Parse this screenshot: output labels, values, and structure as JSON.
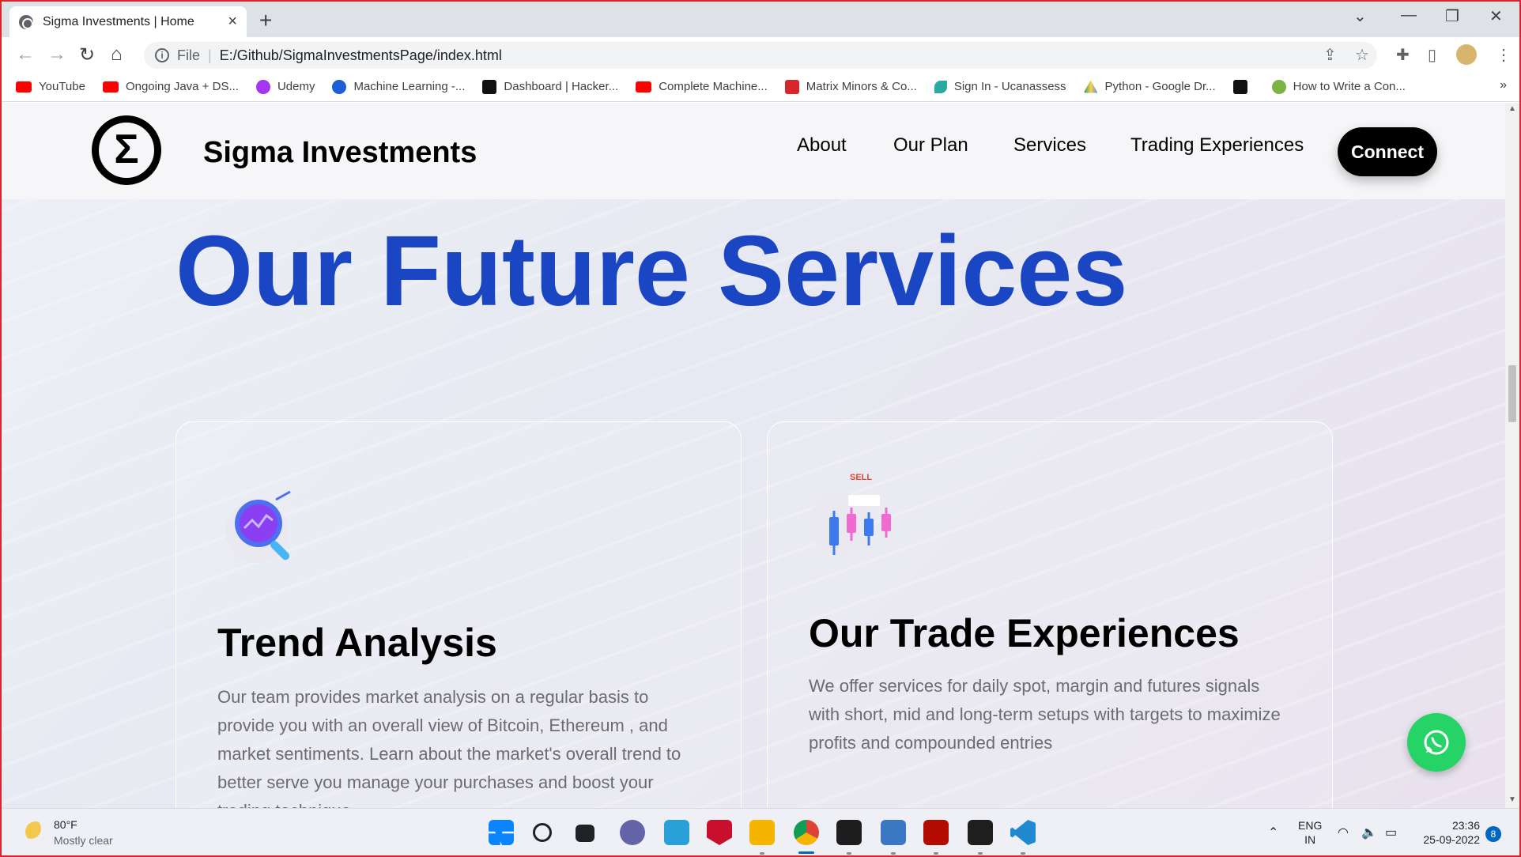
{
  "browser": {
    "tab_title": "Sigma Investments | Home",
    "address_scheme": "File",
    "address_url": "E:/Github/SigmaInvestmentsPage/index.html",
    "bookmarks": [
      {
        "label": "YouTube",
        "color": "#ff0000"
      },
      {
        "label": "Ongoing Java + DS...",
        "color": "#ff0000"
      },
      {
        "label": "Udemy",
        "color": "#a435f0"
      },
      {
        "label": "Machine Learning -...",
        "color": "#1f5fd6"
      },
      {
        "label": "Dashboard | Hacker...",
        "color": "#111111"
      },
      {
        "label": "Complete Machine...",
        "color": "#ff0000"
      },
      {
        "label": "Matrix Minors & Co...",
        "color": "#d9262b"
      },
      {
        "label": "Sign In - Ucanassess",
        "color": "#2aa9a1"
      },
      {
        "label": "Python - Google Dr...",
        "color": "#1fa463"
      },
      {
        "label": "",
        "color": "#111111"
      },
      {
        "label": "How to Write a Con...",
        "color": "#7cb342"
      }
    ],
    "more_bookmarks": "»"
  },
  "site": {
    "brand": "Sigma Investments",
    "logo_symbol": "Σ",
    "nav": [
      "About",
      "Our Plan",
      "Services",
      "Trading Experiences"
    ],
    "connect_label": "Connect",
    "hero_title": "Our Future Services",
    "cards": [
      {
        "icon": "magnifier-chart-icon",
        "title": "Trend Analysis",
        "text": "Our team provides market analysis on a regular basis to provide you with an overall view of Bitcoin, Ethereum , and market sentiments. Learn about the market's overall trend to better serve you manage your purchases and boost your trading technique"
      },
      {
        "icon": "candlestick-sell-icon",
        "title": "Our Trade Experiences",
        "text": "We offer services for daily spot, margin and futures signals with short, mid and long-term setups with targets to maximize profits and compounded entries",
        "badge": "SELL"
      }
    ]
  },
  "taskbar": {
    "weather_temp": "80°F",
    "weather_desc": "Mostly clear",
    "lang_line1": "ENG",
    "lang_line2": "IN",
    "time": "23:36",
    "date": "25-09-2022",
    "notifications": "8"
  }
}
